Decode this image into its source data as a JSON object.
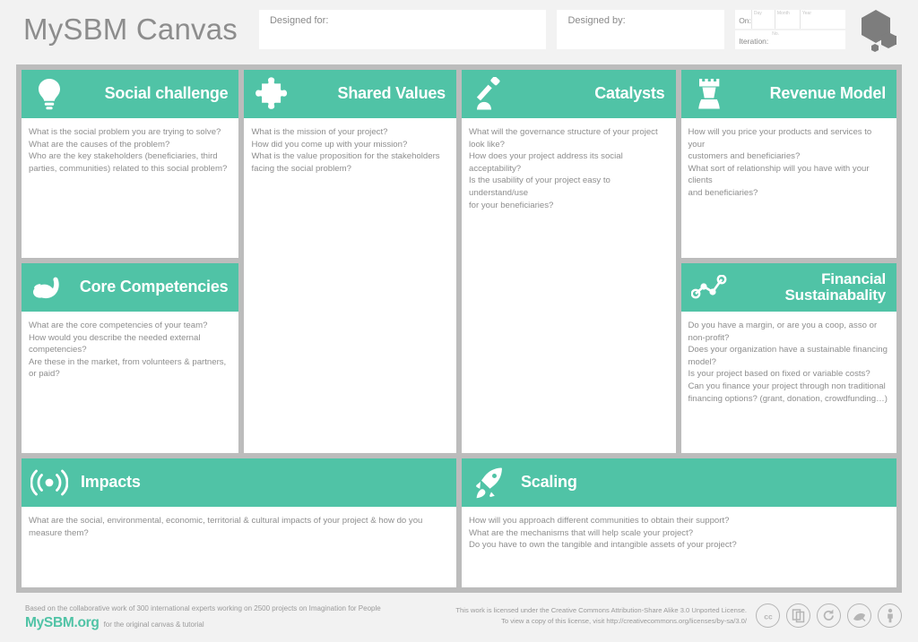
{
  "header": {
    "app_title": "MySBM Canvas",
    "designed_for_label": "Designed for:",
    "designed_for_value": "",
    "designed_by_label": "Designed by:",
    "designed_by_value": "",
    "on_label": "On:",
    "day_label": "Day",
    "month_label": "Month",
    "year_label": "Year",
    "day_value": "",
    "month_value": "",
    "year_value": "",
    "iteration_label": "Iteration:",
    "iteration_no_label": "No.",
    "iteration_value": "",
    "logo_icon": "hexagon-logo"
  },
  "colors": {
    "accent": "#50c3a6",
    "frame": "#bcbcbc",
    "page_background": "#f2f2f2",
    "text": "#8e8e8e",
    "logo_gray": "#7d7d7d"
  },
  "blocks": {
    "social_challenge": {
      "title": "Social challenge",
      "icon": "lightbulb-icon",
      "prompts": [
        "What is the social problem you are trying to solve?",
        "What are the causes of the problem?",
        "Who are the key stakeholders (beneficiaries, third",
        "parties, communities) related to this social problem?"
      ]
    },
    "core_competencies": {
      "title": "Core Competencies",
      "icon": "flexed-bicep-icon",
      "prompts": [
        "What are the core competencies of your team?",
        "How would you describe the needed external competencies?",
        "Are these in the market, from volunteers & partners, or paid?"
      ]
    },
    "shared_values": {
      "title": "Shared Values",
      "icon": "puzzle-piece-icon",
      "prompts": [
        "What is the mission of your project?",
        "How did you come up with your mission?",
        "What is the value proposition for the stakeholders",
        "facing the social problem?"
      ]
    },
    "catalysts": {
      "title": "Catalysts",
      "icon": "gavel-icon",
      "prompts": [
        "What will the governance structure of your project look like?",
        "How does your project address its social acceptability?",
        "Is the usability of your project easy to understand/use",
        "for your beneficiaries?"
      ]
    },
    "revenue_model": {
      "title": "Revenue Model",
      "icon": "chess-rook-icon",
      "prompts": [
        "How will you price your products and services to your",
        "customers and beneficiaries?",
        "What sort of relationship will you have with your clients",
        "and beneficiaries?"
      ]
    },
    "financial_sustainability": {
      "title_line1": "Financial",
      "title_line2": "Sustainabality",
      "icon": "line-chart-nodes-icon",
      "prompts": [
        "Do you have a margin, or are you a coop, asso or non-profit?",
        "Does your organization have a sustainable financing model?",
        "Is your project based on fixed or variable costs?",
        "Can you finance your project through non traditional",
        "financing options? (grant, donation, crowdfunding…)"
      ]
    },
    "impacts": {
      "title": "Impacts",
      "icon": "broadcast-signal-icon",
      "prompts": [
        "What are the social, environmental, economic, territorial & cultural impacts of your project & how do you measure them?"
      ]
    },
    "scaling": {
      "title": "Scaling",
      "icon": "rocket-icon",
      "prompts": [
        "How will you approach different communities to obtain their support?",
        "What are the mechanisms that will help scale your project?",
        "Do you have to own the tangible and intangible assets of your project?"
      ]
    }
  },
  "footer": {
    "credit": "Based on the collaborative work of 300 international experts working on 2500 projects on Imagination for People",
    "brand_name": "MySBM.org",
    "brand_sub": "for the original canvas & tutorial",
    "license_line1": "This work is licensed under the Creative Commons Attribution-Share Alike 3.0 Unported License.",
    "license_line2": "To view a copy of this license, visit http://creativecommons.org/licenses/by-sa/3.0/",
    "badges": [
      "cc-icon",
      "copy-icon",
      "share-alike-icon",
      "remix-icon",
      "attribution-icon"
    ]
  }
}
